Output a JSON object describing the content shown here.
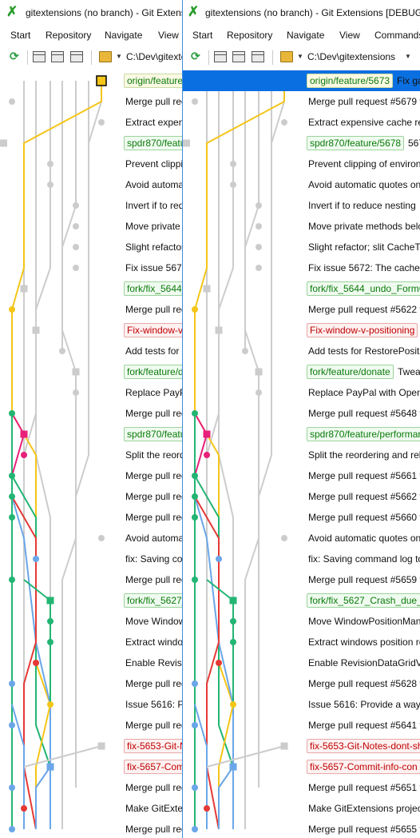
{
  "window_back": {
    "title": "gitextensions (no branch) - Git Extensions",
    "path": "C:\\Dev\\gitextensions"
  },
  "window_front": {
    "title": "gitextensions (no branch) - Git Extensions [DEBUG]",
    "path": "C:\\Dev\\gitextensions"
  },
  "menu": [
    "Start",
    "Repository",
    "Navigate",
    "View",
    "Commands"
  ],
  "toolbar_icons": [
    "refresh-icon",
    "layout-icon",
    "layout-icon",
    "layout-icon",
    "folder-icon"
  ],
  "colors": {
    "selection": "#0a6fe0",
    "green_branch": "#22b573",
    "gold_branch": "#f5c518",
    "red_branch": "#e53935",
    "blue_branch": "#6aa6e8",
    "magenta_branch": "#e8207a",
    "gray_branch": "#cccccc"
  },
  "commits": [
    {
      "type": "badge",
      "color": "gold",
      "label": "origin/feature/5673",
      "after": "Fix ga"
    },
    {
      "type": "text",
      "text": "Merge pull request #5679 f"
    },
    {
      "type": "text",
      "text": "Extract expensive cache reb"
    },
    {
      "type": "badge",
      "color": "green",
      "label": "spdr870/feature/5678",
      "after": "567"
    },
    {
      "type": "text",
      "text": "Prevent clipping of environ"
    },
    {
      "type": "text",
      "text": "Avoid automatic quotes on"
    },
    {
      "type": "text",
      "text": "Invert if to reduce nesting"
    },
    {
      "type": "text",
      "text": "Move private methods belo"
    },
    {
      "type": "text",
      "text": "Slight refactor; slit CacheTo"
    },
    {
      "type": "text",
      "text": "Fix issue 5672: The caches o"
    },
    {
      "type": "badge",
      "color": "green",
      "label": "fork/fix_5644_undo_FormC"
    },
    {
      "type": "text",
      "text": "Merge pull request #5622 fr"
    },
    {
      "type": "badge",
      "color": "red",
      "label": "Fix-window-v-positioning"
    },
    {
      "type": "text",
      "text": "Add tests for RestorePositic"
    },
    {
      "type": "badge",
      "color": "green",
      "label": "fork/feature/donate",
      "after": "Twea"
    },
    {
      "type": "text",
      "text": "Replace PayPal with Open C"
    },
    {
      "type": "text",
      "text": "Merge pull request #5648 fr"
    },
    {
      "type": "badge",
      "color": "green",
      "label": "spdr870/feature/performar"
    },
    {
      "type": "text",
      "text": "Split the reordering and reb"
    },
    {
      "type": "text",
      "text": "Merge pull request #5661 fr"
    },
    {
      "type": "text",
      "text": "Merge pull request #5662 fr"
    },
    {
      "type": "text",
      "text": "Merge pull request #5660 fr"
    },
    {
      "type": "text",
      "text": "Avoid automatic quotes on"
    },
    {
      "type": "text",
      "text": "fix: Saving command log to"
    },
    {
      "type": "text",
      "text": "Merge pull request #5659 fr"
    },
    {
      "type": "badge",
      "color": "green",
      "label": "fork/fix_5627_Crash_due_to"
    },
    {
      "type": "text",
      "text": "Move WindowPositionMan"
    },
    {
      "type": "text",
      "text": "Extract windows position re"
    },
    {
      "type": "text",
      "text": "Enable RevisionDataGridVie"
    },
    {
      "type": "text",
      "text": "Merge pull request #5628 fr"
    },
    {
      "type": "text",
      "text": "Issue 5616: Provide a way to"
    },
    {
      "type": "text",
      "text": "Merge pull request #5641 fr"
    },
    {
      "type": "badge",
      "color": "red",
      "label": "fix-5653-Git-Notes-dont-sh"
    },
    {
      "type": "badge",
      "color": "red",
      "label": "fix-5657-Commit-info-con"
    },
    {
      "type": "text",
      "text": "Merge pull request #5651 fr"
    },
    {
      "type": "text",
      "text": "Make GitExtensions project"
    },
    {
      "type": "text",
      "text": "Merge pull request #5655 fr"
    }
  ]
}
